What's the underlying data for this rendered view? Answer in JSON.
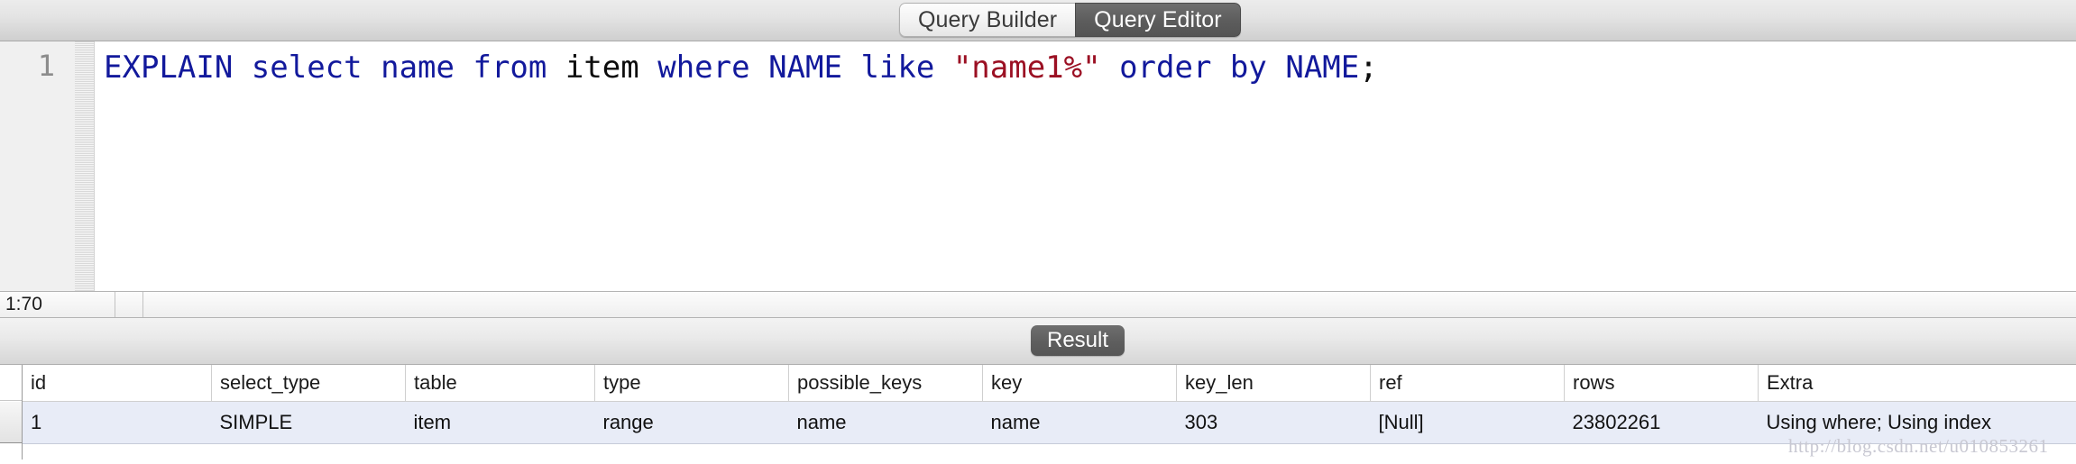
{
  "tabs": {
    "query_builder": "Query Builder",
    "query_editor": "Query Editor"
  },
  "editor": {
    "line_number": "1",
    "tokens": [
      {
        "text": "EXPLAIN",
        "type": "kw"
      },
      {
        "text": " ",
        "type": "punc"
      },
      {
        "text": "select",
        "type": "kw"
      },
      {
        "text": " ",
        "type": "punc"
      },
      {
        "text": "name",
        "type": "kw"
      },
      {
        "text": " ",
        "type": "punc"
      },
      {
        "text": "from",
        "type": "kw"
      },
      {
        "text": " ",
        "type": "punc"
      },
      {
        "text": "item",
        "type": "id"
      },
      {
        "text": " ",
        "type": "punc"
      },
      {
        "text": "where",
        "type": "kw"
      },
      {
        "text": " ",
        "type": "punc"
      },
      {
        "text": "NAME",
        "type": "kw"
      },
      {
        "text": " ",
        "type": "punc"
      },
      {
        "text": "like",
        "type": "kw"
      },
      {
        "text": " ",
        "type": "punc"
      },
      {
        "text": "\"name1%\"",
        "type": "str"
      },
      {
        "text": " ",
        "type": "punc"
      },
      {
        "text": "order",
        "type": "kw"
      },
      {
        "text": " ",
        "type": "punc"
      },
      {
        "text": "by",
        "type": "kw"
      },
      {
        "text": " ",
        "type": "punc"
      },
      {
        "text": "NAME",
        "type": "kw"
      },
      {
        "text": ";",
        "type": "punc"
      }
    ],
    "full_text": "EXPLAIN select name from item where NAME like \"name1%\" order by NAME;"
  },
  "statusbar": {
    "cursor_position": "1:70"
  },
  "result_panel": {
    "tab_label": "Result",
    "columns": [
      "id",
      "select_type",
      "table",
      "type",
      "possible_keys",
      "key",
      "key_len",
      "ref",
      "rows",
      "Extra"
    ],
    "rows": [
      [
        "1",
        "SIMPLE",
        "item",
        "range",
        "name",
        "name",
        "303",
        "[Null]",
        "23802261",
        "Using where; Using index"
      ]
    ]
  },
  "watermark": {
    "text": "http://blog.csdn.net/u010853261"
  },
  "colors": {
    "keyword": "#12199c",
    "string": "#9b1023",
    "identifier": "#0c0c0c",
    "active_tab_bg": "#5c5c5c",
    "row_highlight": "#e8ecf7"
  }
}
